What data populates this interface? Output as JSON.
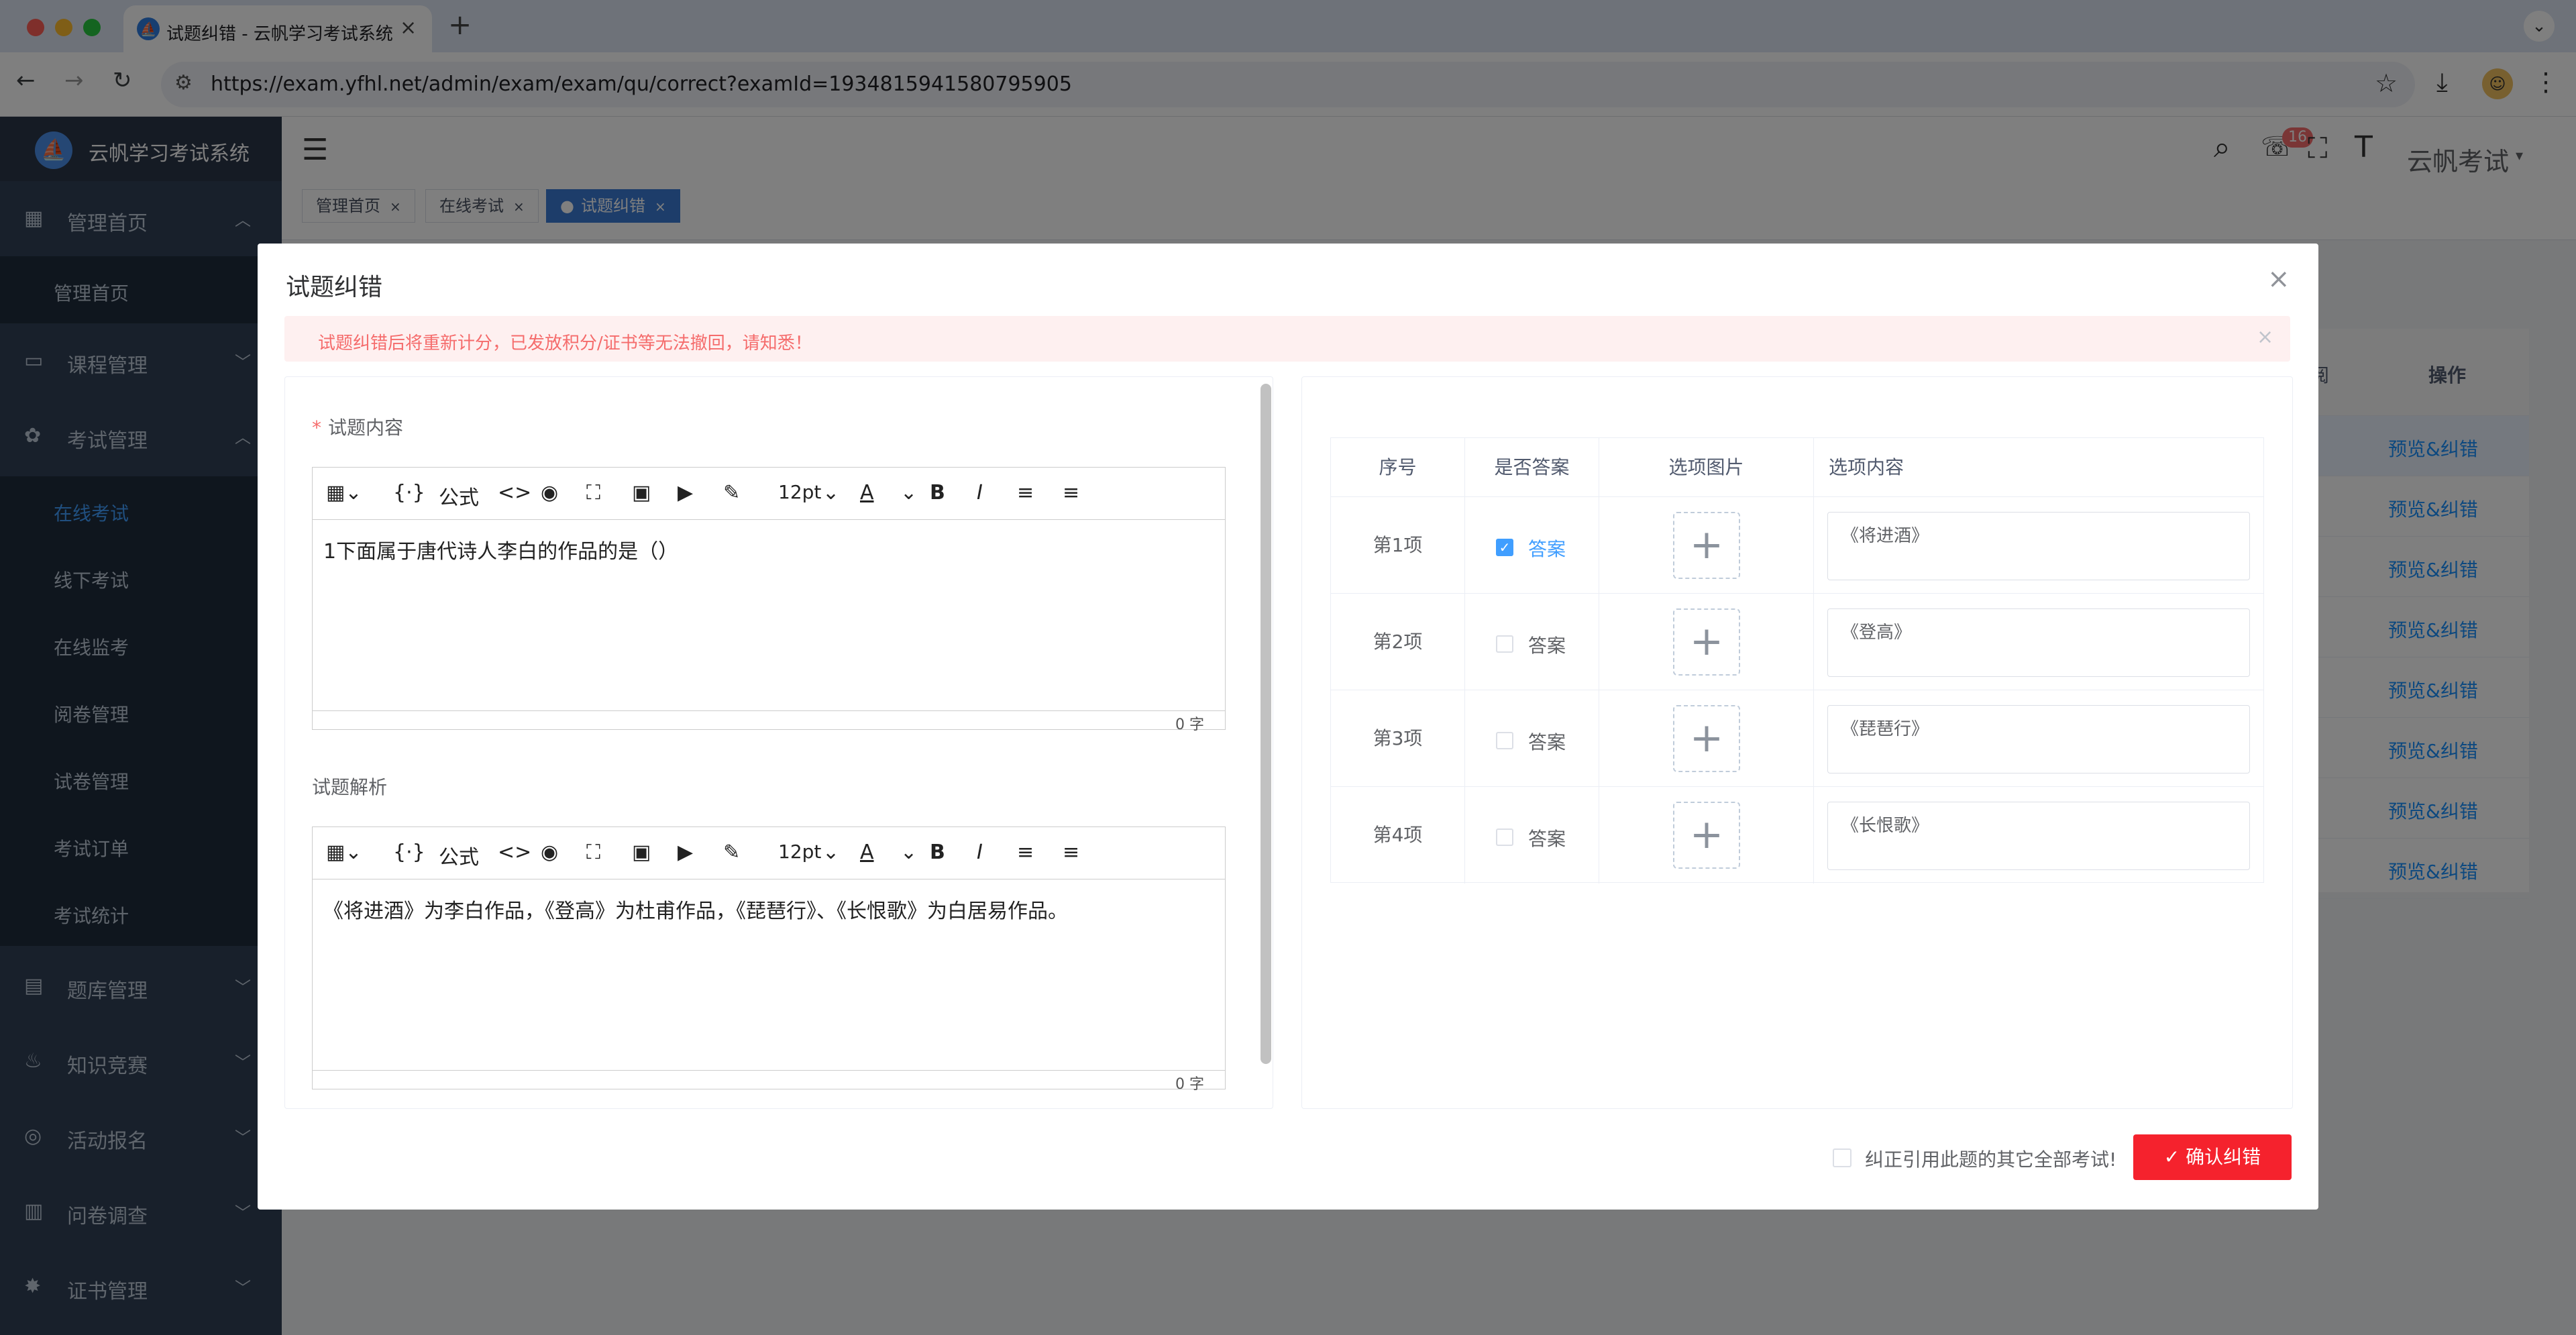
{
  "browser": {
    "tab_title": "试题纠错 - 云帆学习考试系统",
    "url": "https://exam.yfhl.net/admin/exam/exam/qu/correct?examId=1934815941580795905",
    "traffic_light_colors": [
      "#ff5f57",
      "#febc2e",
      "#28c840"
    ]
  },
  "app": {
    "title": "云帆学习考试系统",
    "user_name": "云帆考试",
    "notification_count": "16",
    "accent_color": "#409eff"
  },
  "sidebar": {
    "menus": [
      {
        "label": "管理首页",
        "icon": "dashboard-icon",
        "expanded": true,
        "children": [
          {
            "label": "管理首页"
          }
        ]
      },
      {
        "label": "课程管理",
        "icon": "monitor-icon",
        "expanded": false
      },
      {
        "label": "考试管理",
        "icon": "exam-icon",
        "expanded": true,
        "children": [
          {
            "label": "在线考试",
            "active": true
          },
          {
            "label": "线下考试"
          },
          {
            "label": "在线监考"
          },
          {
            "label": "阅卷管理"
          },
          {
            "label": "试卷管理"
          },
          {
            "label": "考试订单"
          },
          {
            "label": "考试统计"
          }
        ]
      },
      {
        "label": "题库管理",
        "icon": "document-icon",
        "expanded": false
      },
      {
        "label": "知识竞赛",
        "icon": "fire-icon",
        "expanded": false
      },
      {
        "label": "活动报名",
        "icon": "target-icon",
        "expanded": false
      },
      {
        "label": "问卷调查",
        "icon": "survey-icon",
        "expanded": false
      },
      {
        "label": "证书管理",
        "icon": "certificate-icon",
        "expanded": false
      }
    ]
  },
  "tags": [
    {
      "label": "管理首页",
      "active": false
    },
    {
      "label": "在线考试",
      "active": false
    },
    {
      "label": "试题纠错",
      "active": true
    }
  ],
  "background_table": {
    "header_partial": "阅",
    "header_actions": "操作",
    "row_action": "预览&纠错",
    "rows": 8
  },
  "dialog": {
    "title": "试题纠错",
    "alert": "试题纠错后将重新计分，已发放积分/证书等无法撤回，请知悉！",
    "content_label": "试题内容",
    "analysis_label": "试题解析",
    "editor_toolbar": {
      "formula": "公式",
      "font_size": "12pt"
    },
    "content_text": "1下面属于唐代诗人李白的作品的是（）",
    "analysis_text": "《将进酒》为李白作品，《登高》为杜甫作品，《琵琶行》、《长恨歌》为白居易作品。",
    "word_count": "0 字",
    "options_table": {
      "headers": [
        "序号",
        "是否答案",
        "选项图片",
        "选项内容"
      ],
      "answer_label": "答案",
      "rows": [
        {
          "index": "第1项",
          "is_answer": true,
          "content": "《将进酒》"
        },
        {
          "index": "第2项",
          "is_answer": false,
          "content": "《登高》"
        },
        {
          "index": "第3项",
          "is_answer": false,
          "content": "《琵琶行》"
        },
        {
          "index": "第4项",
          "is_answer": false,
          "content": "《长恨歌》"
        }
      ]
    },
    "fix_all_label": "纠正引用此题的其它全部考试!",
    "confirm_label": "确认纠错",
    "confirm_color": "#f5222d"
  }
}
